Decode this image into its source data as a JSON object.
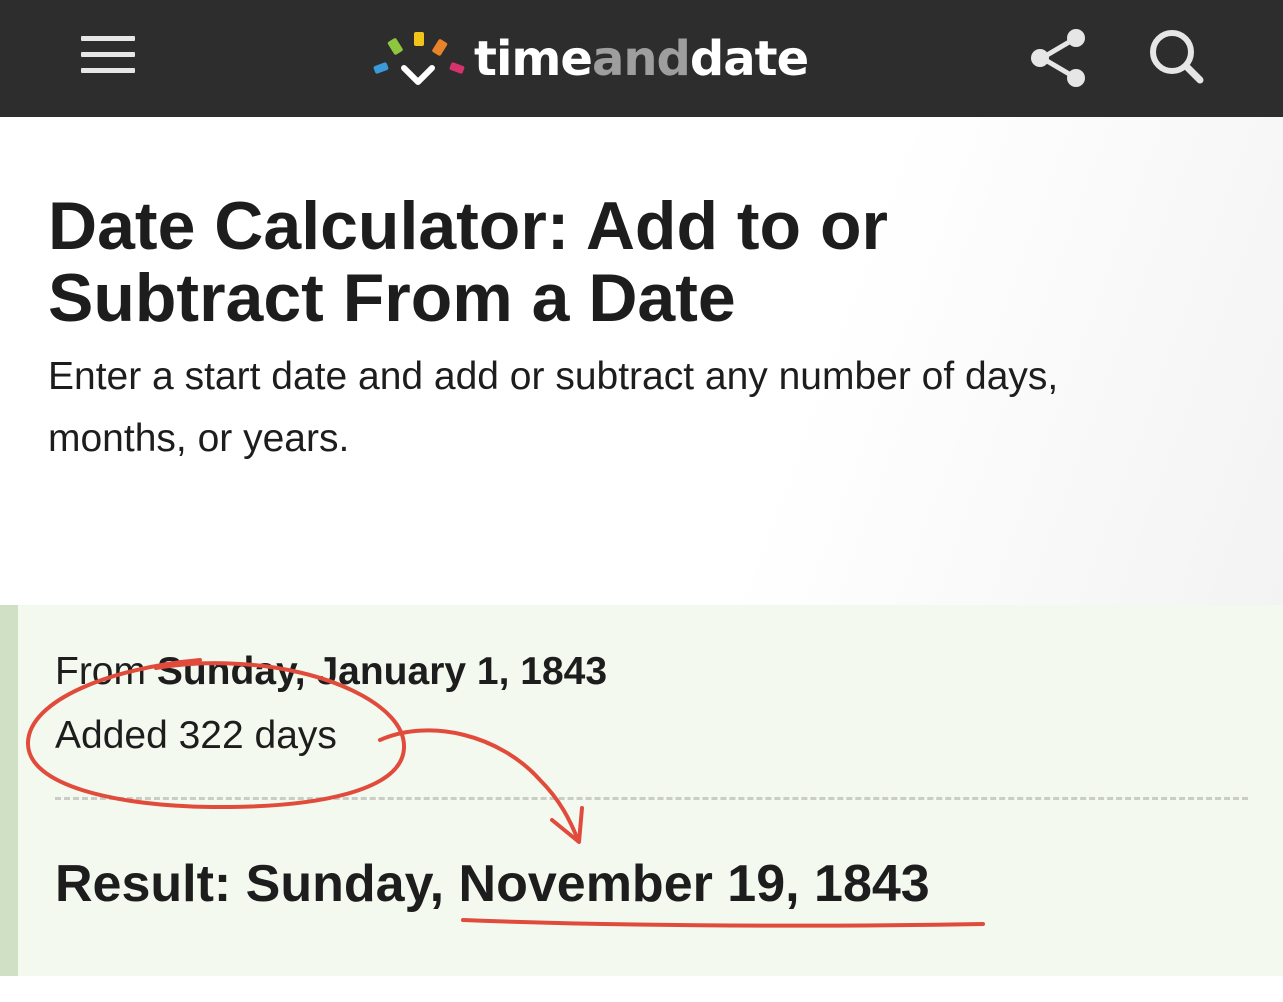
{
  "header": {
    "menu_icon": "hamburger-menu-icon",
    "logo": {
      "part1": "time",
      "part2": "and",
      "part3": "date",
      "ray_colors": [
        "#3b9ad9",
        "#8dc63f",
        "#f2c41a",
        "#e8832a",
        "#d6336c"
      ],
      "check_color": "#ffffff"
    },
    "share_icon": "share-icon",
    "search_icon": "search-icon",
    "background": "#2d2d2d"
  },
  "page": {
    "title": "Date Calculator: Add to or Subtract From a Date",
    "subtitle": "Enter a start date and add or subtract any number of days, months, or years."
  },
  "result": {
    "from_label": "From",
    "from_date": "Sunday, January 1, 1843",
    "added": "Added 322 days",
    "result_text": "Result: Sunday, November 19, 1843",
    "box_background": "#f3f9ef",
    "accent_color": "#cfe0c4"
  },
  "annotation": {
    "color": "#e14b3b",
    "shapes": [
      "ellipse-around-added",
      "arrow-to-result-date",
      "underline-result-date"
    ]
  }
}
